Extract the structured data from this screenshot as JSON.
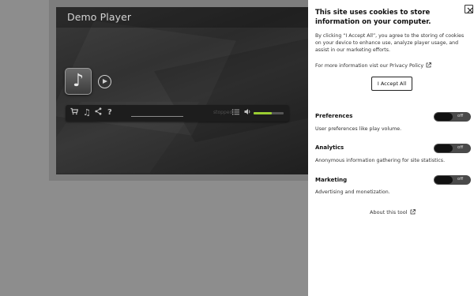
{
  "player": {
    "title": "Demo Player",
    "status_text": "stopped",
    "volume_level": 0.6,
    "icons": [
      "music-note-icon",
      "play-icon",
      "cart-icon",
      "music-icon",
      "share-icon",
      "help-icon",
      "playlist-icon",
      "volume-icon"
    ]
  },
  "consent": {
    "title": "This site uses cookies to store information on your computer.",
    "description": "By clicking “I Accept All”, you agree to the storing of cookies on your device to enhance use, analyze player usage, and assist in our marketing efforts.",
    "privacy_text": "For more information vist our Privacy Policy",
    "accept_label": "I Accept All",
    "categories": [
      {
        "label": "Preferences",
        "description": "User preferences like play volume.",
        "state": "off"
      },
      {
        "label": "Analytics",
        "description": "Anonymous information gathering for site statistics.",
        "state": "off"
      },
      {
        "label": "Marketing",
        "description": "Advertising and monetization.",
        "state": "off"
      }
    ],
    "about_text": "About this tool"
  },
  "colors": {
    "overlay_bg": "#8d8d8d",
    "panel_bg": "#ffffff",
    "toggle_bg": "#4a4a4a",
    "volume_fill": "#9acd32"
  }
}
